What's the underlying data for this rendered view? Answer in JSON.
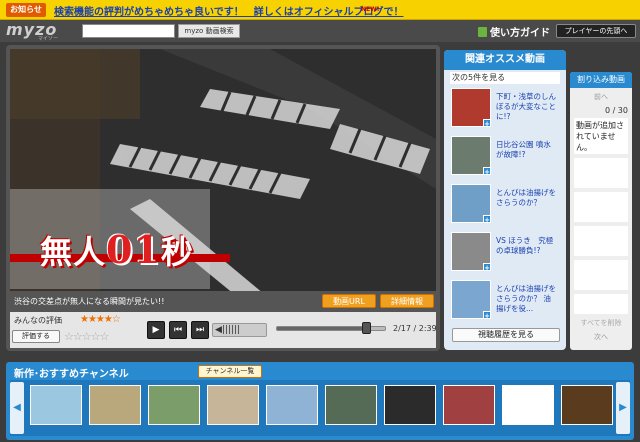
{
  "notice": {
    "badge": "お知らせ",
    "text": "検索機能の評判がめちゃめちゃ良いです！　詳しくはオフィシャルブログで！",
    "new_label": "NEW!"
  },
  "header": {
    "logo": "myzo",
    "logo_sub": "マイゾー",
    "search_value": "",
    "search_button": "myzo 動画検索",
    "guide_label": "使い方ガイド",
    "player_top_button": "プレイヤーの先頭へ"
  },
  "player": {
    "caption_prefix": "無人",
    "caption_number": "01",
    "caption_suffix": "秒",
    "title": "渋谷の交差点が無人になる瞬間が見たい!!",
    "url_button": "動画URL",
    "detail_button": "詳細情報",
    "rating_label": "みんなの評価",
    "rating_stars": "★★★★☆",
    "rating_value": 4,
    "rate_button": "評価する",
    "rate_stars": "☆☆☆☆☆",
    "play_icon": "play-icon",
    "prev_icon": "prev-icon",
    "next_icon": "next-icon",
    "time": "2/17 / 2:39",
    "progress": 0.82,
    "volume_icon": "speaker-icon"
  },
  "related": {
    "header": "関連オススメ動画",
    "next_link": "次の5件を見る",
    "items": [
      {
        "text": "下町・浅草のしんぼるが大変なことに!?",
        "color": "#b03a2e"
      },
      {
        "text": "日比谷公園 噴水が故障!?",
        "color": "#6b7c6f"
      },
      {
        "text": "とんびは油揚げをさらうのか？",
        "color": "#6f9fc7"
      },
      {
        "text": "VS ほうき　究極の卓球勝負!?",
        "color": "#8a8a8a"
      },
      {
        "text": "とんびは油揚げをさらうのか？ 油揚げを役...",
        "color": "#7aa6cf"
      }
    ],
    "history_button": "視聴履歴を見る"
  },
  "interrupt": {
    "header": "割り込み動画",
    "prev": "前へ",
    "count": "0 / 30",
    "message": "動画が追加されていません。",
    "clear": "すべてを削除",
    "next": "次へ"
  },
  "channels": {
    "title": "新作･おすすめチャンネル",
    "list_button": "チャンネル一覧",
    "left_arrow": "◀",
    "right_arrow": "▶",
    "thumbs": [
      {
        "color": "#9cc7e0"
      },
      {
        "color": "#b9a87c"
      },
      {
        "color": "#7b9d6a"
      },
      {
        "color": "#c7b59a"
      },
      {
        "color": "#8fb3d4"
      },
      {
        "color": "#556b55"
      },
      {
        "color": "#2b2b2b"
      },
      {
        "color": "#a04040"
      },
      {
        "color": "#ffffff"
      },
      {
        "color": "#5a3b1e"
      }
    ]
  }
}
